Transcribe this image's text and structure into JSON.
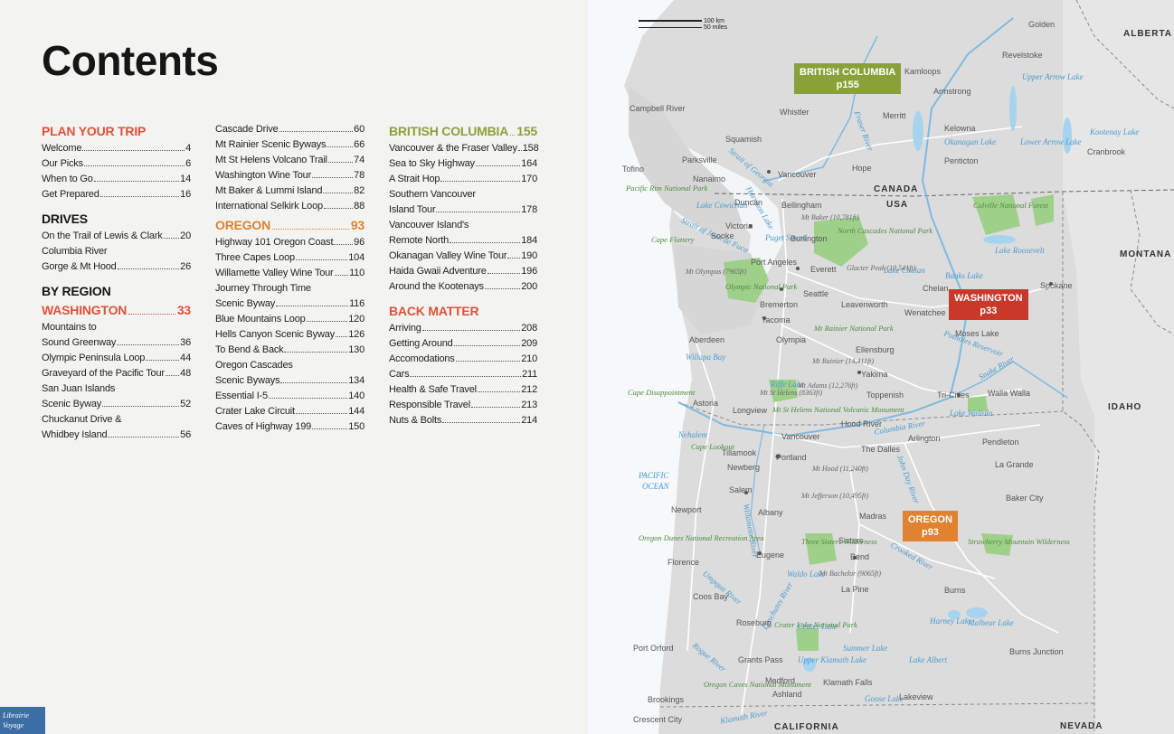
{
  "page_title": "Contents",
  "col1": {
    "plan": {
      "heading": "PLAN YOUR TRIP",
      "entries": [
        {
          "t": "Welcome",
          "p": "4"
        },
        {
          "t": "Our Picks",
          "p": "6"
        },
        {
          "t": "When to Go",
          "p": "14"
        },
        {
          "t": "Get Prepared",
          "p": "16"
        }
      ]
    },
    "drives": {
      "heading": "DRIVES",
      "e1": {
        "t": "On the Trail of Lewis & Clark",
        "p": "20"
      },
      "e2_line1": "Columbia River",
      "e2": {
        "t": "Gorge & Mt Hood",
        "p": "26"
      }
    },
    "by_region": {
      "heading": "BY REGION"
    },
    "washington": {
      "heading": "WASHINGTON",
      "page": "33",
      "e1_line1": "Mountains to",
      "e1": {
        "t": "Sound Greenway",
        "p": "36"
      },
      "e2": {
        "t": "Olympic Peninsula Loop",
        "p": "44"
      },
      "e3": {
        "t": "Graveyard of the Pacific Tour",
        "p": "48"
      },
      "e4_line1": "San Juan Islands",
      "e4": {
        "t": "Scenic Byway",
        "p": "52"
      },
      "e5_line1": "Chuckanut Drive &",
      "e5": {
        "t": "Whidbey Island",
        "p": "56"
      }
    }
  },
  "col2": {
    "wa_cont": [
      {
        "t": "Cascade Drive",
        "p": "60"
      },
      {
        "t": "Mt Rainier Scenic Byways",
        "p": "66"
      },
      {
        "t": "Mt St Helens Volcano Trail",
        "p": "74"
      },
      {
        "t": "Washington Wine Tour",
        "p": "78"
      },
      {
        "t": "Mt Baker & Lummi Island",
        "p": "82"
      },
      {
        "t": "International Selkirk Loop",
        "p": "88"
      }
    ],
    "oregon": {
      "heading": "OREGON",
      "page": "93",
      "e1": {
        "t": "Highway 101 Oregon Coast",
        "p": "96"
      },
      "e2": {
        "t": "Three Capes Loop",
        "p": "104"
      },
      "e3": {
        "t": "Willamette Valley Wine Tour",
        "p": "110"
      },
      "e4_line1": "Journey Through Time",
      "e4": {
        "t": "Scenic Byway",
        "p": "116"
      },
      "e5": {
        "t": "Blue Mountains Loop",
        "p": "120"
      },
      "e6": {
        "t": "Hells Canyon Scenic Byway",
        "p": "126"
      },
      "e7": {
        "t": "To Bend & Back",
        "p": "130"
      },
      "e8_line1": "Oregon Cascades",
      "e8": {
        "t": "Scenic Byways",
        "p": "134"
      },
      "e9": {
        "t": "Essential I-5",
        "p": "140"
      },
      "e10": {
        "t": "Crater Lake Circuit",
        "p": "144"
      },
      "e11": {
        "t": "Caves of Highway 199",
        "p": "150"
      }
    }
  },
  "col3": {
    "bc": {
      "heading": "BRITISH COLUMBIA",
      "page": "155",
      "e1": {
        "t": "Vancouver & the Fraser Valley",
        "p": "158"
      },
      "e2": {
        "t": "Sea to Sky Highway",
        "p": "164"
      },
      "e3": {
        "t": "A Strait Hop",
        "p": "170"
      },
      "e4_line1": "Southern Vancouver",
      "e4": {
        "t": "Island Tour",
        "p": "178"
      },
      "e5_line1": "Vancouver Island's",
      "e5": {
        "t": "Remote North",
        "p": "184"
      },
      "e6": {
        "t": "Okanagan Valley Wine Tour",
        "p": "190"
      },
      "e7": {
        "t": "Haida Gwaii Adventure",
        "p": "196"
      },
      "e8": {
        "t": "Around the Kootenays",
        "p": "200"
      }
    },
    "back": {
      "heading": "BACK MATTER",
      "entries": [
        {
          "t": "Arriving",
          "p": "208"
        },
        {
          "t": "Getting Around",
          "p": "209"
        },
        {
          "t": "Accomodations",
          "p": "210"
        },
        {
          "t": "Cars",
          "p": "211"
        },
        {
          "t": "Health & Safe Travel",
          "p": "212"
        },
        {
          "t": "Responsible Travel",
          "p": "213"
        },
        {
          "t": "Nuts & Bolts",
          "p": "214"
        }
      ]
    }
  },
  "map": {
    "scale_km": "100 km",
    "scale_miles": "50 miles",
    "callouts": {
      "bc": {
        "name": "BRITISH COLUMBIA",
        "page": "p155"
      },
      "wa": {
        "name": "WASHINGTON",
        "page": "p33"
      },
      "or": {
        "name": "OREGON",
        "page": "p93"
      }
    },
    "regions": [
      "ALBERTA",
      "CANADA",
      "USA",
      "MONTANA",
      "IDAHO",
      "CALIFORNIA",
      "NEVADA"
    ],
    "water": [
      "PACIFIC",
      "OCEAN",
      "Strait of Georgia",
      "Strait of Juan de Fuca",
      "Puget Sound",
      "Columbia River",
      "Snake River",
      "Fraser River",
      "Okanagan Lake",
      "Kootenay Lake",
      "Upper Arrow Lake",
      "Lower Arrow Lake",
      "Lake Roosevelt",
      "Banks Lake",
      "Lake Chelan",
      "Willapa Bay",
      "Crater Lake",
      "Upper Klamath Lake",
      "Harney Lake",
      "Malheur Lake",
      "Waldo Lake",
      "Lake Albert",
      "Summer Lake",
      "Goose Lake",
      "Rogue River",
      "Umpqua River",
      "Willamette River",
      "Deschutes River",
      "John Day River",
      "Crooked River",
      "Klamath River",
      "Potholes Reservoir",
      "Riffe Lake",
      "Lake Wallula",
      "Lake Cowichan",
      "Nehalem",
      "Harrison Lake"
    ],
    "cities": [
      "Golden",
      "Revelstoke",
      "Kamloops",
      "Armstrong",
      "Merritt",
      "Kelowna",
      "Penticton",
      "Cranbrook",
      "Campbell River",
      "Whistler",
      "Squamish",
      "Parksville",
      "Nanaimo",
      "Hope",
      "Vancouver",
      "Duncan",
      "Victoria",
      "Sooke",
      "Bellingham",
      "Burlington",
      "Everett",
      "Port Angeles",
      "Seattle",
      "Bremerton",
      "Tacoma",
      "Olympia",
      "Leavenworth",
      "Wenatchee",
      "Chelan",
      "Spokane",
      "Moses Lake",
      "Ellensburg",
      "Yakima",
      "Toppenish",
      "Tri-Cities",
      "Walla Walla",
      "Aberdeen",
      "Astoria",
      "Longview",
      "Vancouver",
      "Hood River",
      "The Dalles",
      "Arlington",
      "Pendleton",
      "La Grande",
      "Baker City",
      "Tillamook",
      "Newberg",
      "Portland",
      "Salem",
      "Newport",
      "Albany",
      "Madras",
      "Eugene",
      "Sisters",
      "Bend",
      "La Pine",
      "Florence",
      "Coos Bay",
      "Roseburg",
      "Burns",
      "Port Orford",
      "Grants Pass",
      "Medford",
      "Ashland",
      "Klamath Falls",
      "Lakeview",
      "Brookings",
      "Crescent City",
      "Burns Junction",
      "Tofino"
    ],
    "parks": [
      "Olympic National Park",
      "North Cascades National Park",
      "Mt Rainier National Park",
      "Mt St Helens National Volcanic Monument",
      "Colville National Forest",
      "Three Sisters Wilderness",
      "Strawberry Mountain Wilderness",
      "Crater Lake National Park",
      "Oregon Dunes National Recreation Area",
      "Oregon Caves National Monument",
      "Pacific Rim National Park",
      "Cape Flattery",
      "Cape Disappointment",
      "Cape Lookout"
    ],
    "peaks": [
      "Mt Baker (10,781ft)",
      "Glacier Peak (10,541ft)",
      "Mt Olympus (7965ft)",
      "Mt Rainier (14,411ft)",
      "Mt Adams (12,276ft)",
      "Mt St Helens (8363ft)",
      "Mt Hood (11,240ft)",
      "Mt Jefferson (10,495ft)",
      "Mt Bachelor (9065ft)"
    ]
  },
  "watermark": "Librairie Voyage"
}
